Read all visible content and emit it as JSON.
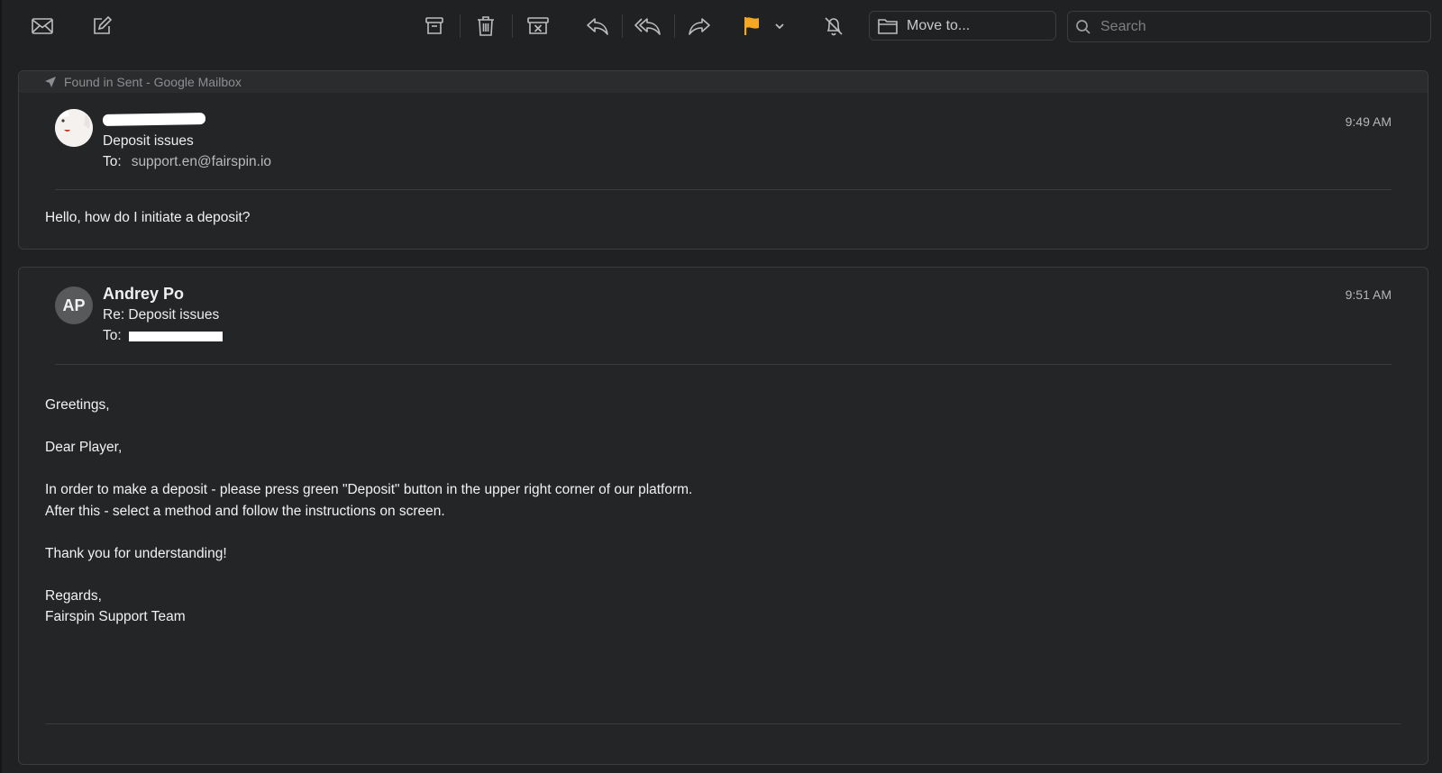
{
  "toolbar": {
    "move_to_label": "Move to...",
    "search_placeholder": "Search",
    "flag_color": "#f5a623"
  },
  "messages": [
    {
      "found_in": "Found in Sent - Google Mailbox",
      "sender": "",
      "subject": "Deposit issues",
      "to_label": "To:",
      "to_address": "support.en@fairspin.io",
      "time": "9:49 AM",
      "body": [
        "Hello, how do I initiate a deposit?"
      ]
    },
    {
      "sender": "Andrey Po",
      "avatar_initials": "AP",
      "subject": "Re: Deposit issues",
      "to_label": "To:",
      "to_address": "",
      "time": "9:51 AM",
      "body": [
        "Greetings,",
        "",
        "Dear Player,",
        "",
        "In order to make a deposit - please press green \"Deposit\" button in the upper right corner of our platform.",
        "After this - select a method and follow the instructions on screen.",
        "",
        "Thank you for understanding!",
        "",
        "Regards,",
        "Fairspin Support Team"
      ]
    }
  ]
}
